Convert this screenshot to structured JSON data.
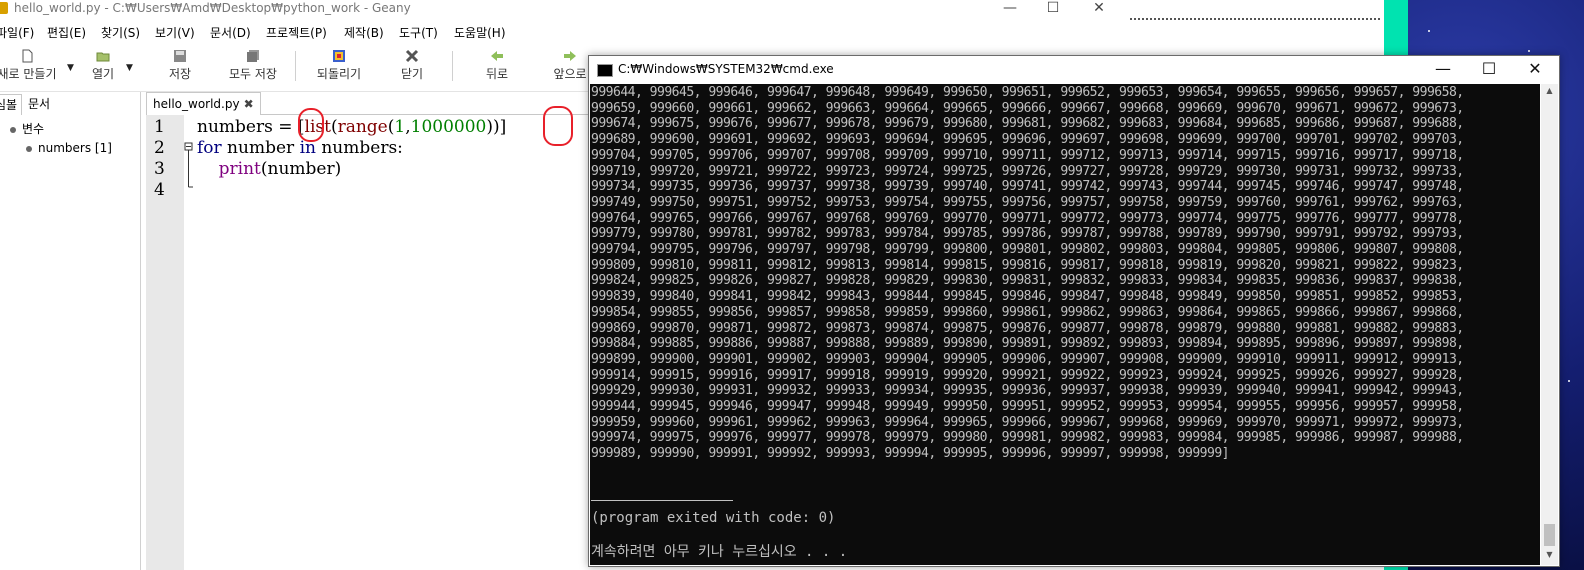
{
  "geany": {
    "title": "hello_world.py - C:₩Users₩Amd₩Desktop₩python_work - Geany",
    "window_controls": {
      "minimize": "—",
      "maximize": "☐",
      "close": "✕"
    },
    "menu": [
      "파일(F)",
      "편집(E)",
      "찾기(S)",
      "보기(V)",
      "문서(D)",
      "프로젝트(P)",
      "제작(B)",
      "도구(T)",
      "도움말(H)"
    ],
    "toolbar": {
      "new": "새로 만들기",
      "open": "열기",
      "save": "저장",
      "save_all": "모두 저장",
      "revert": "되돌리기",
      "close": "닫기",
      "back": "뒤로",
      "forward": "앞으로"
    },
    "sidebar": {
      "tabs": [
        "심볼",
        "문서"
      ],
      "tree": {
        "group": "변수",
        "item": "numbers [1]"
      }
    },
    "editor": {
      "tab_label": "hello_world.py",
      "tab_close": "✖",
      "line_numbers": [
        "1",
        "2",
        "3",
        "4"
      ],
      "code": {
        "l1_a": "numbers = ",
        "l1_b": "[",
        "l1_c": "list",
        "l1_d": "(",
        "l1_e": "range",
        "l1_f": "(",
        "l1_g": "1",
        "l1_h": ",",
        "l1_i": "1000000",
        "l1_j": "))",
        "l1_k": "]",
        "l2_kw1": "for",
        "l2_a": " number ",
        "l2_kw2": "in",
        "l2_b": " numbers:",
        "l3_indent": "    ",
        "l3_fn": "print",
        "l3_a": "(number)"
      }
    }
  },
  "cmd": {
    "title": "C:₩Windows₩SYSTEM32₩cmd.exe",
    "window_controls": {
      "minimize": "—",
      "maximize": "☐",
      "close": "✕"
    },
    "output_lines": [
      "999644, 999645, 999646, 999647, 999648, 999649, 999650, 999651, 999652, 999653, 999654, 999655, 999656, 999657, 999658,",
      "999659, 999660, 999661, 999662, 999663, 999664, 999665, 999666, 999667, 999668, 999669, 999670, 999671, 999672, 999673,",
      "999674, 999675, 999676, 999677, 999678, 999679, 999680, 999681, 999682, 999683, 999684, 999685, 999686, 999687, 999688,",
      "999689, 999690, 999691, 999692, 999693, 999694, 999695, 999696, 999697, 999698, 999699, 999700, 999701, 999702, 999703,",
      "999704, 999705, 999706, 999707, 999708, 999709, 999710, 999711, 999712, 999713, 999714, 999715, 999716, 999717, 999718,",
      "999719, 999720, 999721, 999722, 999723, 999724, 999725, 999726, 999727, 999728, 999729, 999730, 999731, 999732, 999733,",
      "999734, 999735, 999736, 999737, 999738, 999739, 999740, 999741, 999742, 999743, 999744, 999745, 999746, 999747, 999748,",
      "999749, 999750, 999751, 999752, 999753, 999754, 999755, 999756, 999757, 999758, 999759, 999760, 999761, 999762, 999763,",
      "999764, 999765, 999766, 999767, 999768, 999769, 999770, 999771, 999772, 999773, 999774, 999775, 999776, 999777, 999778,",
      "999779, 999780, 999781, 999782, 999783, 999784, 999785, 999786, 999787, 999788, 999789, 999790, 999791, 999792, 999793,",
      "999794, 999795, 999796, 999797, 999798, 999799, 999800, 999801, 999802, 999803, 999804, 999805, 999806, 999807, 999808,",
      "999809, 999810, 999811, 999812, 999813, 999814, 999815, 999816, 999817, 999818, 999819, 999820, 999821, 999822, 999823,",
      "999824, 999825, 999826, 999827, 999828, 999829, 999830, 999831, 999832, 999833, 999834, 999835, 999836, 999837, 999838,",
      "999839, 999840, 999841, 999842, 999843, 999844, 999845, 999846, 999847, 999848, 999849, 999850, 999851, 999852, 999853,",
      "999854, 999855, 999856, 999857, 999858, 999859, 999860, 999861, 999862, 999863, 999864, 999865, 999866, 999867, 999868,",
      "999869, 999870, 999871, 999872, 999873, 999874, 999875, 999876, 999877, 999878, 999879, 999880, 999881, 999882, 999883,",
      "999884, 999885, 999886, 999887, 999888, 999889, 999890, 999891, 999892, 999893, 999894, 999895, 999896, 999897, 999898,",
      "999899, 999900, 999901, 999902, 999903, 999904, 999905, 999906, 999907, 999908, 999909, 999910, 999911, 999912, 999913,",
      "999914, 999915, 999916, 999917, 999918, 999919, 999920, 999921, 999922, 999923, 999924, 999925, 999926, 999927, 999928,",
      "999929, 999930, 999931, 999932, 999933, 999934, 999935, 999936, 999937, 999938, 999939, 999940, 999941, 999942, 999943,",
      "999944, 999945, 999946, 999947, 999948, 999949, 999950, 999951, 999952, 999953, 999954, 999955, 999956, 999957, 999958,",
      "999959, 999960, 999961, 999962, 999963, 999964, 999965, 999966, 999967, 999968, 999969, 999970, 999971, 999972, 999973,",
      "999974, 999975, 999976, 999977, 999978, 999979, 999980, 999981, 999982, 999983, 999984, 999985, 999986, 999987, 999988,",
      "999989, 999990, 999991, 999992, 999993, 999994, 999995, 999996, 999997, 999998, 999999]"
    ],
    "exit_message": "(program exited with code: 0)",
    "prompt": "계속하려면 아무 키나 누르십시오 . . ."
  },
  "colors": {
    "console_bg": "#0c0c0c",
    "console_text": "#c0c0c0",
    "annotation_red": "#e8202a",
    "keyword_blue": "#00007f",
    "number_green": "#007f00",
    "teal_strip": "#00e3b0"
  }
}
